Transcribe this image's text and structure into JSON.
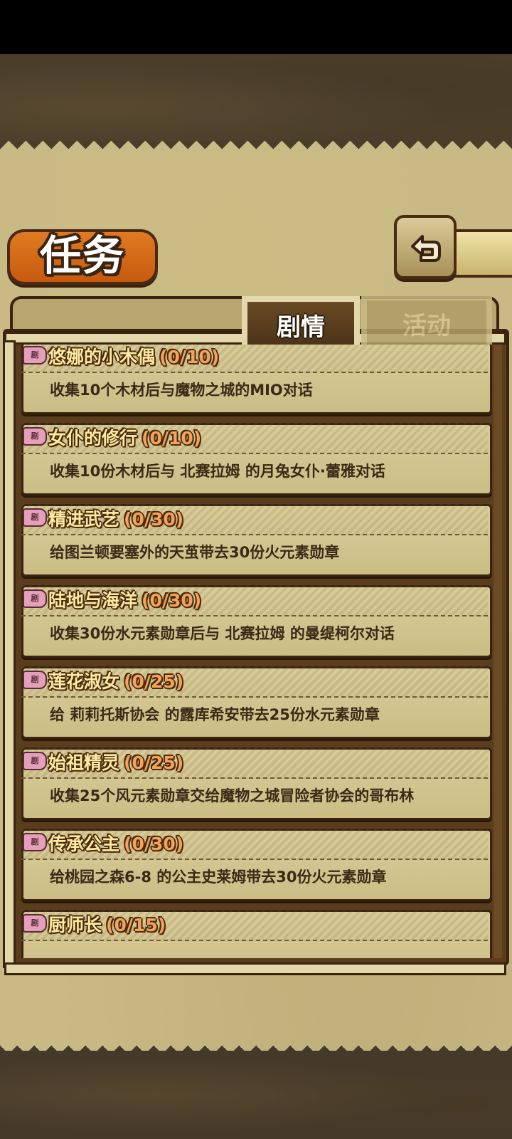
{
  "title": "任务",
  "tabs": [
    {
      "label": "剧情",
      "active": true
    },
    {
      "label": "活动",
      "active": false
    }
  ],
  "back_icon": "return-arrow-icon",
  "quest_icon": "pink-tag-icon",
  "quests": [
    {
      "title": "悠娜的小木偶",
      "progress": "(0/10)",
      "desc": "收集10个木材后与魔物之城的MIO对话"
    },
    {
      "title": "女仆的修行",
      "progress": "(0/10)",
      "desc": "收集10份木材后与 北赛拉姆 的月兔女仆·蕾雅对话"
    },
    {
      "title": "精进武艺",
      "progress": "(0/30)",
      "desc": "给图兰顿要塞外的天茧带去30份火元素勋章"
    },
    {
      "title": "陆地与海洋",
      "progress": "(0/30)",
      "desc": "收集30份水元素勋章后与 北赛拉姆 的曼缇柯尔对话"
    },
    {
      "title": "莲花淑女",
      "progress": "(0/25)",
      "desc": "给 莉莉托斯协会 的露库希安带去25份水元素勋章"
    },
    {
      "title": "始祖精灵",
      "progress": "(0/25)",
      "desc": "收集25个风元素勋章交给魔物之城冒险者协会的哥布林"
    },
    {
      "title": "传承公主",
      "progress": "(0/30)",
      "desc": "给桃园之森6-8 的公主史莱姆带去30份火元素勋章"
    },
    {
      "title": "厨师长",
      "progress": "(0/15)",
      "desc": ""
    }
  ]
}
